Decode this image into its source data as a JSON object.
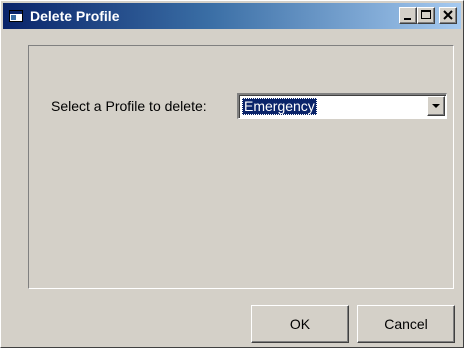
{
  "window": {
    "title": "Delete Profile",
    "title_icon": "app-window-icon",
    "controls": {
      "minimize_icon": "minimize-icon",
      "maximize_icon": "maximize-icon",
      "close_icon": "close-icon"
    }
  },
  "form": {
    "prompt_label": "Select a Profile to delete:",
    "profile_select": {
      "selected_value": "Emergency",
      "dropdown_icon": "chevron-down-icon"
    }
  },
  "buttons": {
    "ok_label": "OK",
    "cancel_label": "Cancel"
  },
  "colors": {
    "titlebar_start": "#0a246a",
    "titlebar_end": "#a6caf0",
    "face": "#d4d0c8",
    "selection": "#0a246a"
  }
}
